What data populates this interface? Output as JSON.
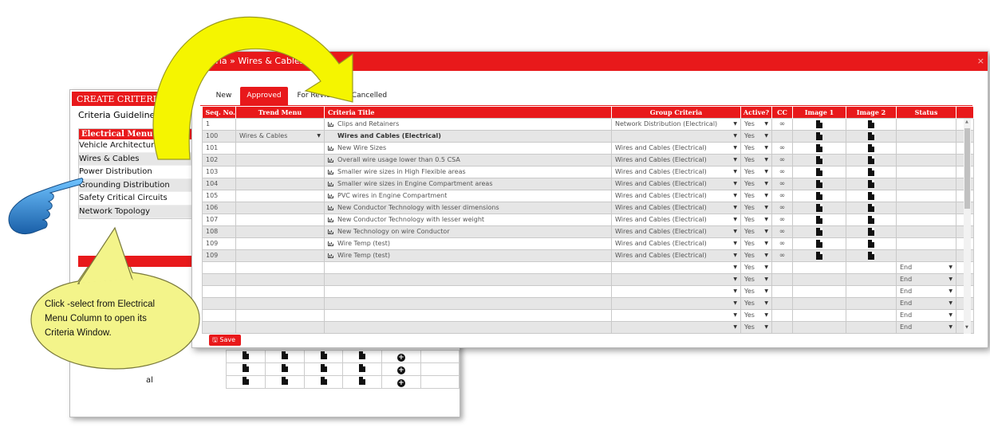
{
  "back_panel": {
    "header": "CREATE CRITERIA",
    "subtitle": "Criteria Guidelines",
    "menu_header": "Electrical Menu",
    "menu_items": [
      "Vehicle Architecture",
      "Wires & Cables",
      "Power Distribution",
      "Grounding Distribution",
      "Safety Critical Circuits",
      "Network Topology"
    ],
    "partial_text": "al"
  },
  "modal": {
    "title": "Criteria » Wires & Cables",
    "close": "×",
    "tabs": [
      "New",
      "Approved",
      "For Review",
      "Cancelled"
    ],
    "active_tab": "Approved",
    "columns": [
      "Seq. No.",
      "Trend Menu",
      "Criteria Title",
      "Group Criteria",
      "Active?",
      "CC",
      "Image 1",
      "Image 2",
      "Status"
    ],
    "rows": [
      {
        "seq": "1",
        "trend": "",
        "title": "Clips and Retainers",
        "group": "Network Distribution (Electrical)",
        "active": "Yes"
      },
      {
        "seq": "100",
        "trend": "Wires & Cables",
        "title": "Wires and Cables (Electrical)",
        "group": "",
        "active": "Yes"
      },
      {
        "seq": "101",
        "trend": "",
        "title": "New Wire Sizes",
        "group": "Wires and Cables (Electrical)",
        "active": "Yes"
      },
      {
        "seq": "102",
        "trend": "",
        "title": "Overall wire usage lower than 0.5 CSA",
        "group": "Wires and Cables (Electrical)",
        "active": "Yes"
      },
      {
        "seq": "103",
        "trend": "",
        "title": "Smaller wire sizes in High Flexible areas",
        "group": "Wires and Cables (Electrical)",
        "active": "Yes"
      },
      {
        "seq": "104",
        "trend": "",
        "title": "Smaller wire sizes in Engine Compartment areas",
        "group": "Wires and Cables (Electrical)",
        "active": "Yes"
      },
      {
        "seq": "105",
        "trend": "",
        "title": "PVC wires in Engine Compartment",
        "group": "Wires and Cables (Electrical)",
        "active": "Yes"
      },
      {
        "seq": "106",
        "trend": "",
        "title": "New Conductor Technology with lesser dimensions",
        "group": "Wires and Cables (Electrical)",
        "active": "Yes"
      },
      {
        "seq": "107",
        "trend": "",
        "title": "New Conductor Technology with lesser weight",
        "group": "Wires and Cables (Electrical)",
        "active": "Yes"
      },
      {
        "seq": "108",
        "trend": "",
        "title": "New Technology on wire Conductor",
        "group": "Wires and Cables (Electrical)",
        "active": "Yes"
      },
      {
        "seq": "109",
        "trend": "",
        "title": "Wire Temp (test)",
        "group": "Wires and Cables (Electrical)",
        "active": "Yes"
      },
      {
        "seq": "109",
        "trend": "",
        "title": "Wire Temp (test)",
        "group": "Wires and Cables (Electrical)",
        "active": "Yes"
      }
    ],
    "empty_rows": [
      {
        "active": "Yes",
        "status": "End"
      },
      {
        "active": "Yes",
        "status": "End"
      },
      {
        "active": "Yes",
        "status": "End"
      },
      {
        "active": "Yes",
        "status": "End"
      },
      {
        "active": "Yes",
        "status": "End"
      },
      {
        "active": "Yes",
        "status": "End"
      }
    ],
    "save_label": "Save"
  },
  "callout": {
    "text": "Click -select from Electrical Menu Column to open its Criteria Window."
  },
  "colors": {
    "accent": "#e8191b",
    "arrow": "#f5f500",
    "bubble": "#f3f48a"
  }
}
